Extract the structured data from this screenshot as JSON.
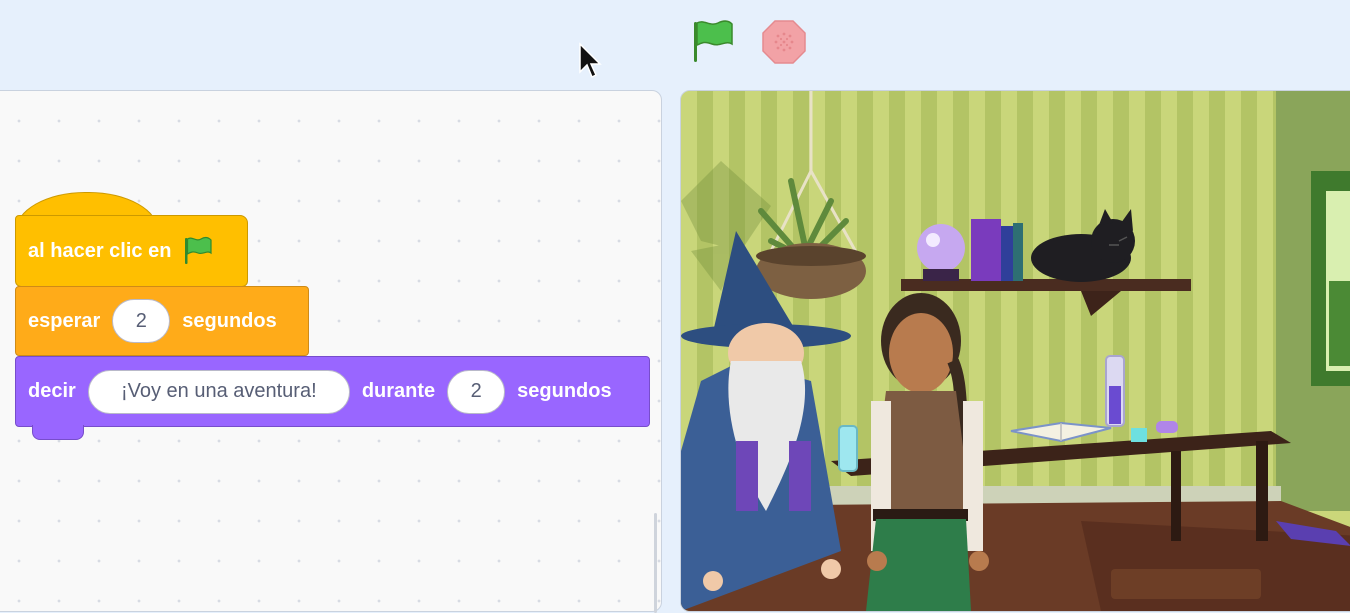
{
  "toolbar": {
    "green_flag": "green-flag-icon",
    "stop": "stop-icon",
    "colors": {
      "flag": "#3fbf3f",
      "stop": "#f2a2a6"
    }
  },
  "blocks": {
    "hat": {
      "label": "al hacer clic en",
      "icon": "green-flag-icon",
      "color": "#ffbf00"
    },
    "wait": {
      "label": "esperar",
      "value": "2",
      "unit": "segundos",
      "color": "#ffab19"
    },
    "say": {
      "label": "decir",
      "message": "¡Voy en una aventura!",
      "during": "durante",
      "value": "2",
      "unit": "segundos",
      "color": "#9966ff"
    }
  },
  "stage": {
    "backdrop": "wizard-room-backdrop",
    "sprites": [
      "wizard-sprite",
      "adventurer-sprite",
      "black-cat",
      "crystal-ball",
      "potion-flask",
      "open-book"
    ]
  }
}
